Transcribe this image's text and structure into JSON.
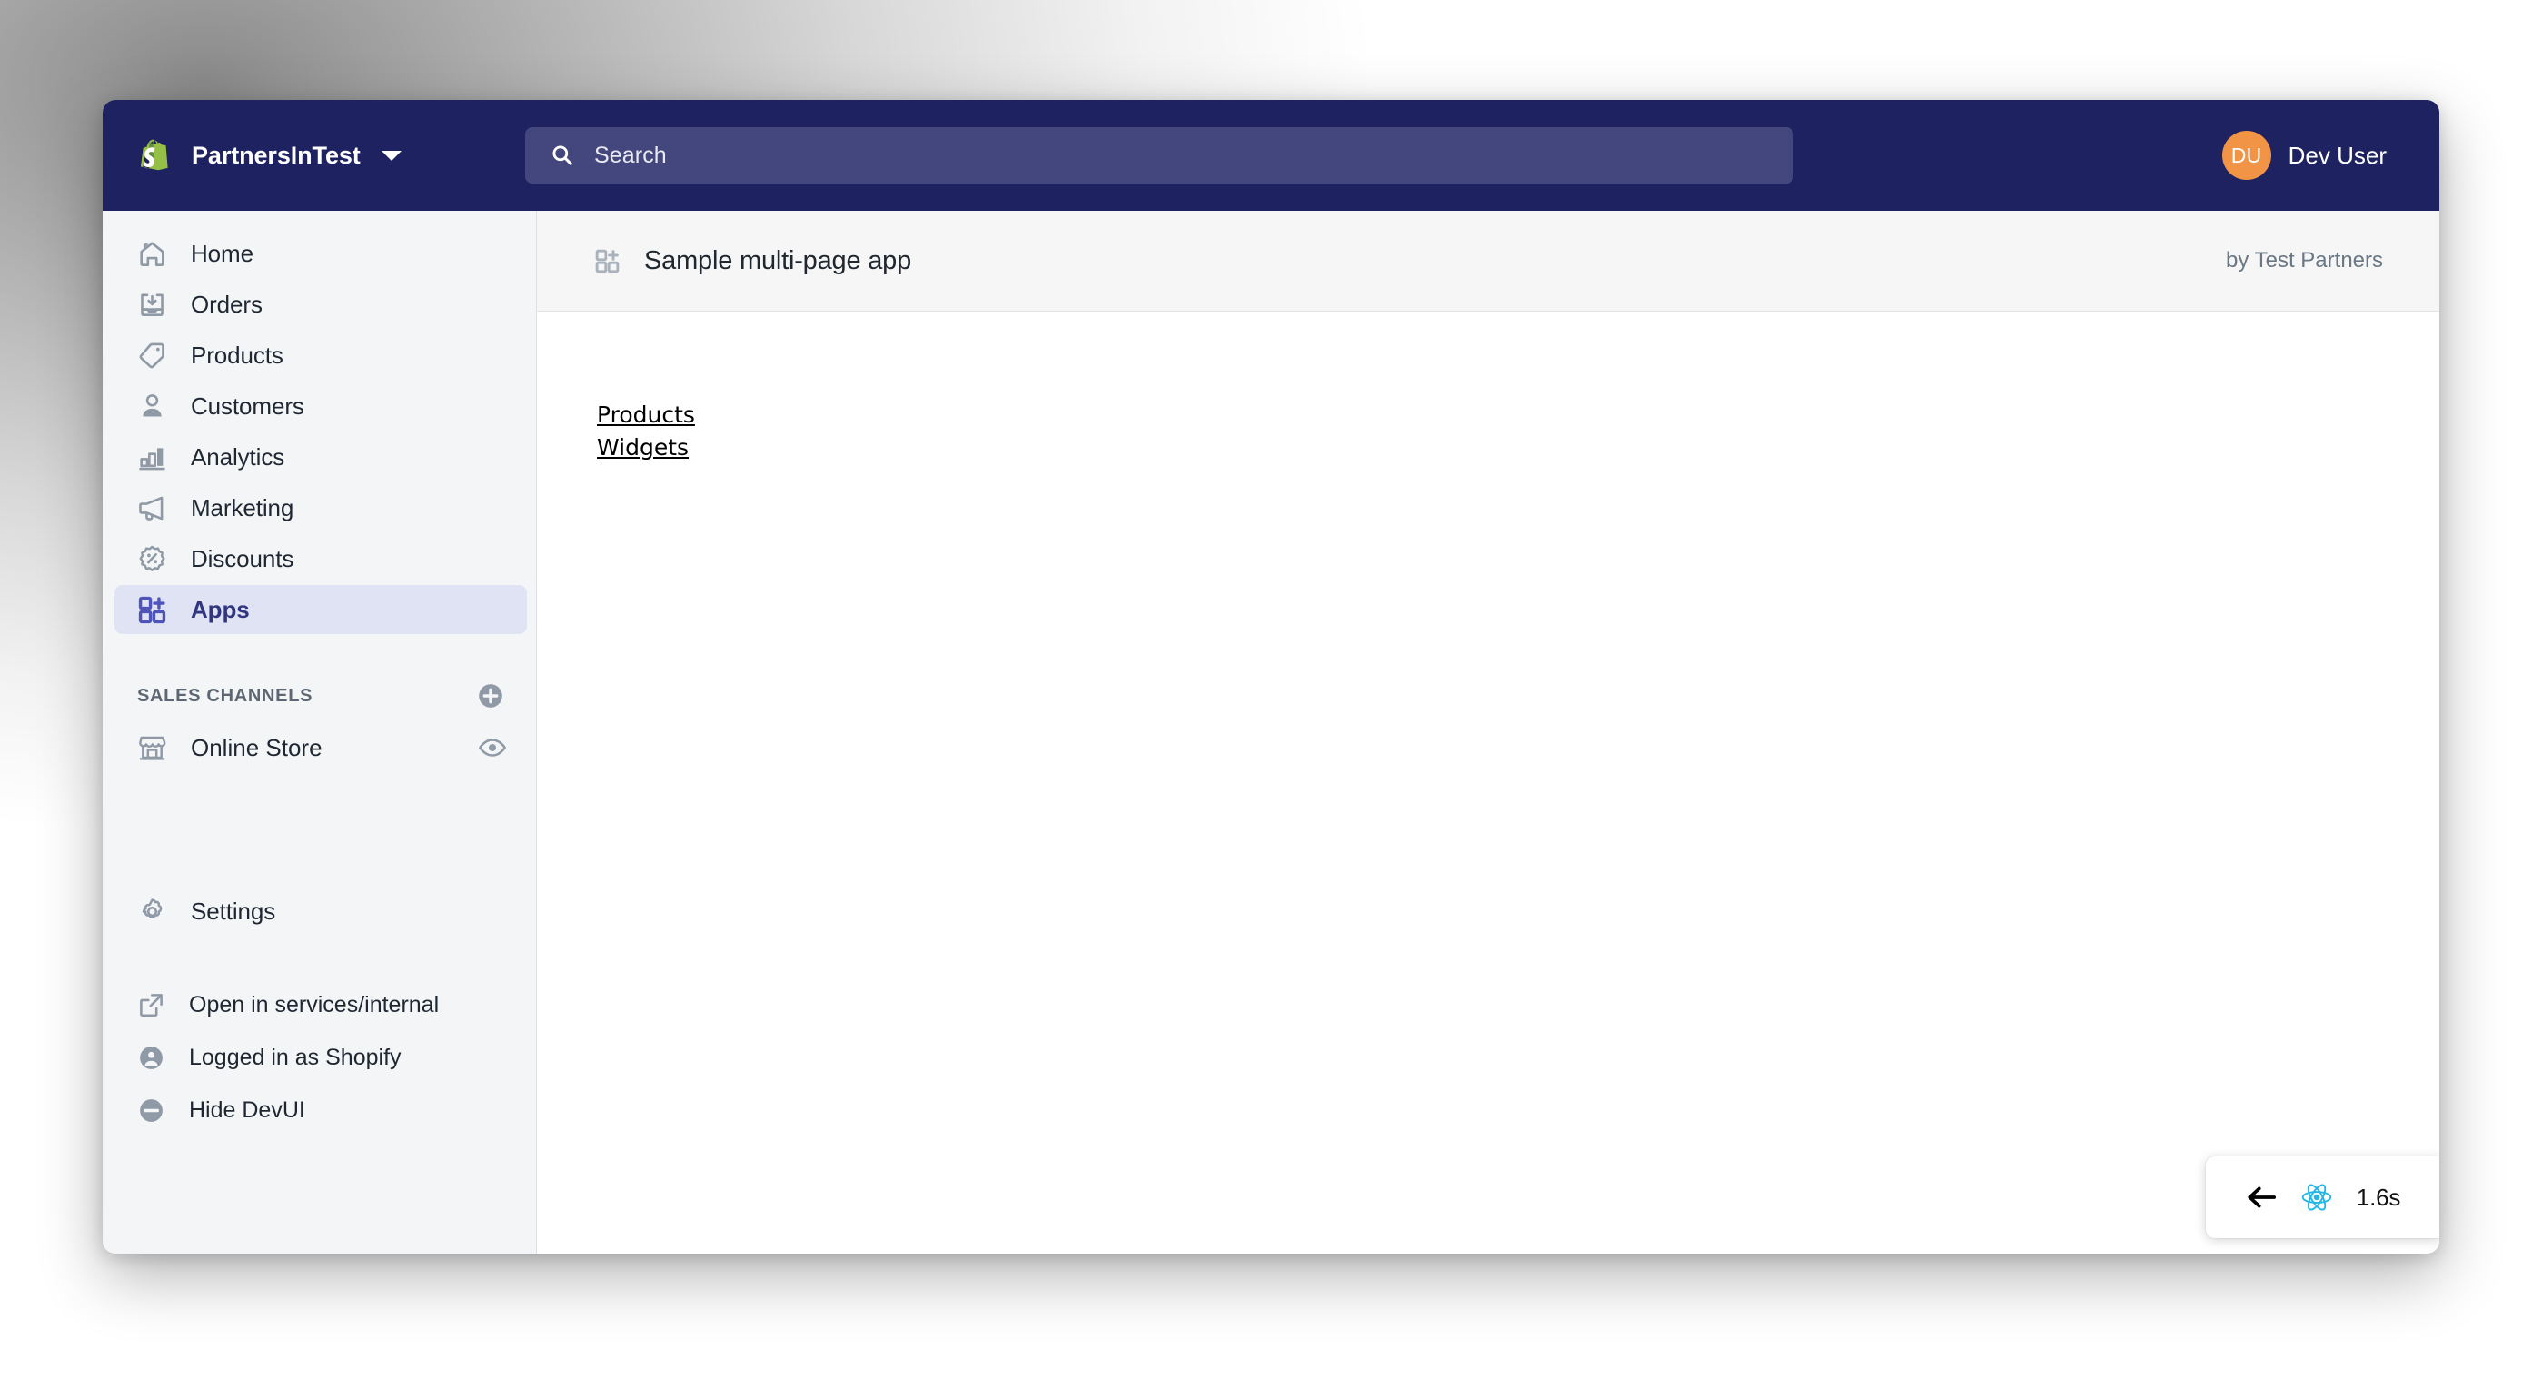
{
  "topbar": {
    "store_name": "PartnersInTest",
    "store_menu_icon": "caret-down-icon",
    "logo_icon": "shopify-bag-logo",
    "search": {
      "placeholder": "Search",
      "value": "",
      "icon": "search-icon"
    },
    "user": {
      "initials": "DU",
      "name": "Dev User",
      "avatar_color": "#f29445"
    },
    "background_color": "#1f2260",
    "search_field_color": "#44477d"
  },
  "sidebar": {
    "background_color": "#f4f5f7",
    "selected_background_color": "#dfe3f3",
    "selected_text_color": "#32357f",
    "items": [
      {
        "label": "Home",
        "icon": "home-icon",
        "selected": false
      },
      {
        "label": "Orders",
        "icon": "orders-icon",
        "selected": false
      },
      {
        "label": "Products",
        "icon": "products-tag-icon",
        "selected": false
      },
      {
        "label": "Customers",
        "icon": "customers-icon",
        "selected": false
      },
      {
        "label": "Analytics",
        "icon": "analytics-bars-icon",
        "selected": false
      },
      {
        "label": "Marketing",
        "icon": "marketing-megaphone-icon",
        "selected": false
      },
      {
        "label": "Discounts",
        "icon": "discounts-percent-icon",
        "selected": false
      },
      {
        "label": "Apps",
        "icon": "apps-grid-plus-icon",
        "selected": true
      }
    ],
    "sales_channels": {
      "title": "SALES CHANNELS",
      "add_icon": "plus-circle-icon",
      "channels": [
        {
          "label": "Online Store",
          "icon": "storefront-icon",
          "action_icon": "eye-view-icon"
        }
      ]
    },
    "settings": {
      "label": "Settings",
      "icon": "gear-icon"
    },
    "devui": {
      "items": [
        {
          "label": "Open in services/internal",
          "icon": "external-link-icon"
        },
        {
          "label": "Logged in as Shopify",
          "icon": "account-circle-icon"
        },
        {
          "label": "Hide DevUI",
          "icon": "minus-circle-icon"
        }
      ]
    }
  },
  "app_header": {
    "icon": "apps-grid-plus-icon",
    "title": "Sample multi-page app",
    "byline": "by Test Partners",
    "background_color": "#f6f6f7"
  },
  "app_content": {
    "links": [
      {
        "label": "Products"
      },
      {
        "label": "Widgets"
      }
    ]
  },
  "react_widget": {
    "back_icon": "arrow-left-icon",
    "react_icon": "react-logo-icon",
    "time_label": "1.6s",
    "react_color": "#22b5e8"
  }
}
